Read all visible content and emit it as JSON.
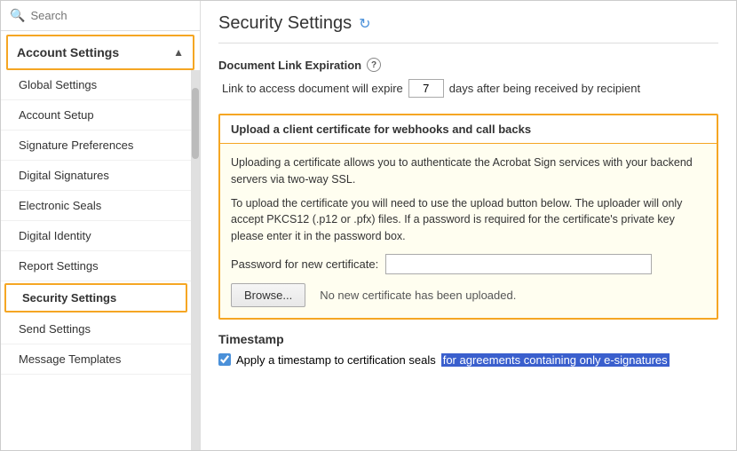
{
  "sidebar": {
    "search_placeholder": "Search",
    "section_label": "Account Settings",
    "items": [
      {
        "id": "global-settings",
        "label": "Global Settings",
        "active": false
      },
      {
        "id": "account-setup",
        "label": "Account Setup",
        "active": false
      },
      {
        "id": "signature-preferences",
        "label": "Signature Preferences",
        "active": false
      },
      {
        "id": "digital-signatures",
        "label": "Digital Signatures",
        "active": false
      },
      {
        "id": "electronic-seals",
        "label": "Electronic Seals",
        "active": false
      },
      {
        "id": "digital-identity",
        "label": "Digital Identity",
        "active": false
      },
      {
        "id": "report-settings",
        "label": "Report Settings",
        "active": false
      },
      {
        "id": "security-settings",
        "label": "Security Settings",
        "active": true
      },
      {
        "id": "send-settings",
        "label": "Send Settings",
        "active": false
      },
      {
        "id": "message-templates",
        "label": "Message Templates",
        "active": false
      }
    ]
  },
  "main": {
    "page_title": "Security Settings",
    "refresh_icon": "↻",
    "doc_link_section": {
      "label": "Document Link Expiration",
      "expiry_text_before": "Link to access document will expire",
      "expiry_days": "7",
      "expiry_text_after": "days after being received by recipient"
    },
    "cert_section": {
      "header": "Upload a client certificate for webhooks and call backs",
      "desc1": "Uploading a certificate allows you to authenticate the Acrobat Sign services with your backend servers via two-way SSL.",
      "desc2": "To upload the certificate you will need to use the upload button below. The uploader will only accept PKCS12 (.p12 or .pfx) files. If a password is required for the certificate's private key please enter it in the password box.",
      "password_label": "Password for new certificate:",
      "password_value": "",
      "browse_label": "Browse...",
      "no_cert_text": "No new certificate has been uploaded."
    },
    "timestamp_section": {
      "title": "Timestamp",
      "checkbox_label_before": "Apply a timestamp to certification seals",
      "checkbox_label_highlighted": "for agreements containing only e-signatures",
      "checkbox_checked": true
    }
  }
}
